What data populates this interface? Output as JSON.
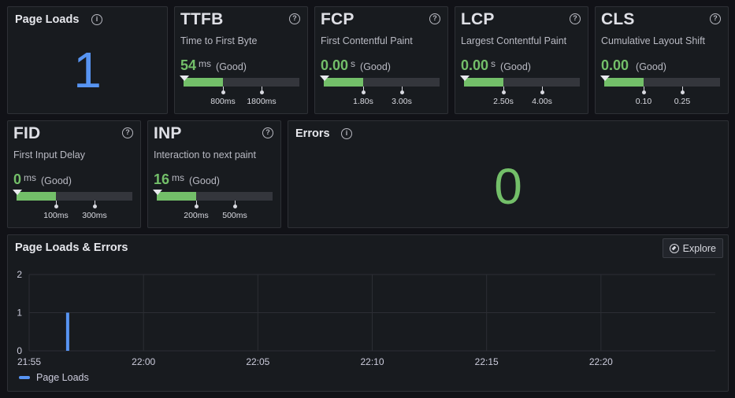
{
  "page_loads": {
    "title": "Page Loads",
    "value": "1"
  },
  "errors": {
    "title": "Errors",
    "value": "0"
  },
  "metrics": [
    {
      "name": "TTFB",
      "desc": "Time to First Byte",
      "value": "54",
      "unit": "ms",
      "rating": "(Good)",
      "fill_fraction": 0.34,
      "thresholds": [
        "800ms",
        "1800ms"
      ]
    },
    {
      "name": "FCP",
      "desc": "First Contentful Paint",
      "value": "0.00",
      "unit": "s",
      "rating": "(Good)",
      "fill_fraction": 0.34,
      "thresholds": [
        "1.80s",
        "3.00s"
      ]
    },
    {
      "name": "LCP",
      "desc": "Largest Contentful Paint",
      "value": "0.00",
      "unit": "s",
      "rating": "(Good)",
      "fill_fraction": 0.34,
      "thresholds": [
        "2.50s",
        "4.00s"
      ]
    },
    {
      "name": "CLS",
      "desc": "Cumulative Layout Shift",
      "value": "0.00",
      "unit": "",
      "rating": "(Good)",
      "fill_fraction": 0.34,
      "thresholds": [
        "0.10",
        "0.25"
      ]
    },
    {
      "name": "FID",
      "desc": "First Input Delay",
      "value": "0",
      "unit": "ms",
      "rating": "(Good)",
      "fill_fraction": 0.34,
      "thresholds": [
        "100ms",
        "300ms"
      ]
    },
    {
      "name": "INP",
      "desc": "Interaction to next paint",
      "value": "16",
      "unit": "ms",
      "rating": "(Good)",
      "fill_fraction": 0.34,
      "thresholds": [
        "200ms",
        "500ms"
      ]
    }
  ],
  "timeseries": {
    "title": "Page Loads & Errors",
    "explore_label": "Explore"
  },
  "colors": {
    "good": "#73bf69",
    "blue": "#5794f2",
    "bg": "#111217",
    "panel": "#181b1f"
  },
  "icons": {
    "info": "info-circle-icon",
    "explore": "compass-icon"
  },
  "chart_data": {
    "type": "bar",
    "x_ticks": [
      "21:55",
      "22:00",
      "22:05",
      "22:10",
      "22:15",
      "22:20"
    ],
    "y_ticks": [
      "0",
      "1",
      "2"
    ],
    "ylim": [
      0,
      2
    ],
    "series": [
      {
        "name": "Page Loads",
        "color": "#5794f2",
        "points": [
          {
            "x": "21:56:40",
            "y": 1
          }
        ]
      }
    ],
    "grid": true,
    "legend_position": "bottom-left"
  }
}
